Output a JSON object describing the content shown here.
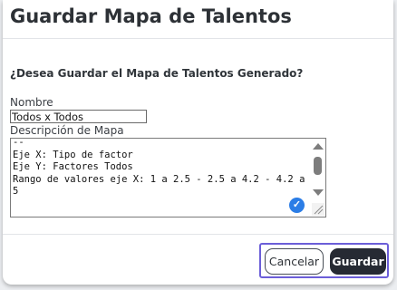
{
  "dialog": {
    "title": "Guardar Mapa de Talentos",
    "question": "¿Desea Guardar el Mapa de Talentos Generado?",
    "name_label": "Nombre",
    "name_value": "Todos x Todos",
    "description_label": "Descripción de Mapa",
    "description_value": "--\nEje X: Tipo de factor\nEje Y: Factores Todos\nRango de valores eje X: 1 a 2.5 - 2.5 a 4.2 - 4.2 a 5",
    "check_badge_icon": "checkmark-circle-icon",
    "buttons": {
      "cancel_label": "Cancelar",
      "save_label": "Guardar"
    }
  },
  "colors": {
    "primary_button": "#262a33",
    "focus_outline": "#6b5ed8",
    "badge": "#2b7de6"
  }
}
